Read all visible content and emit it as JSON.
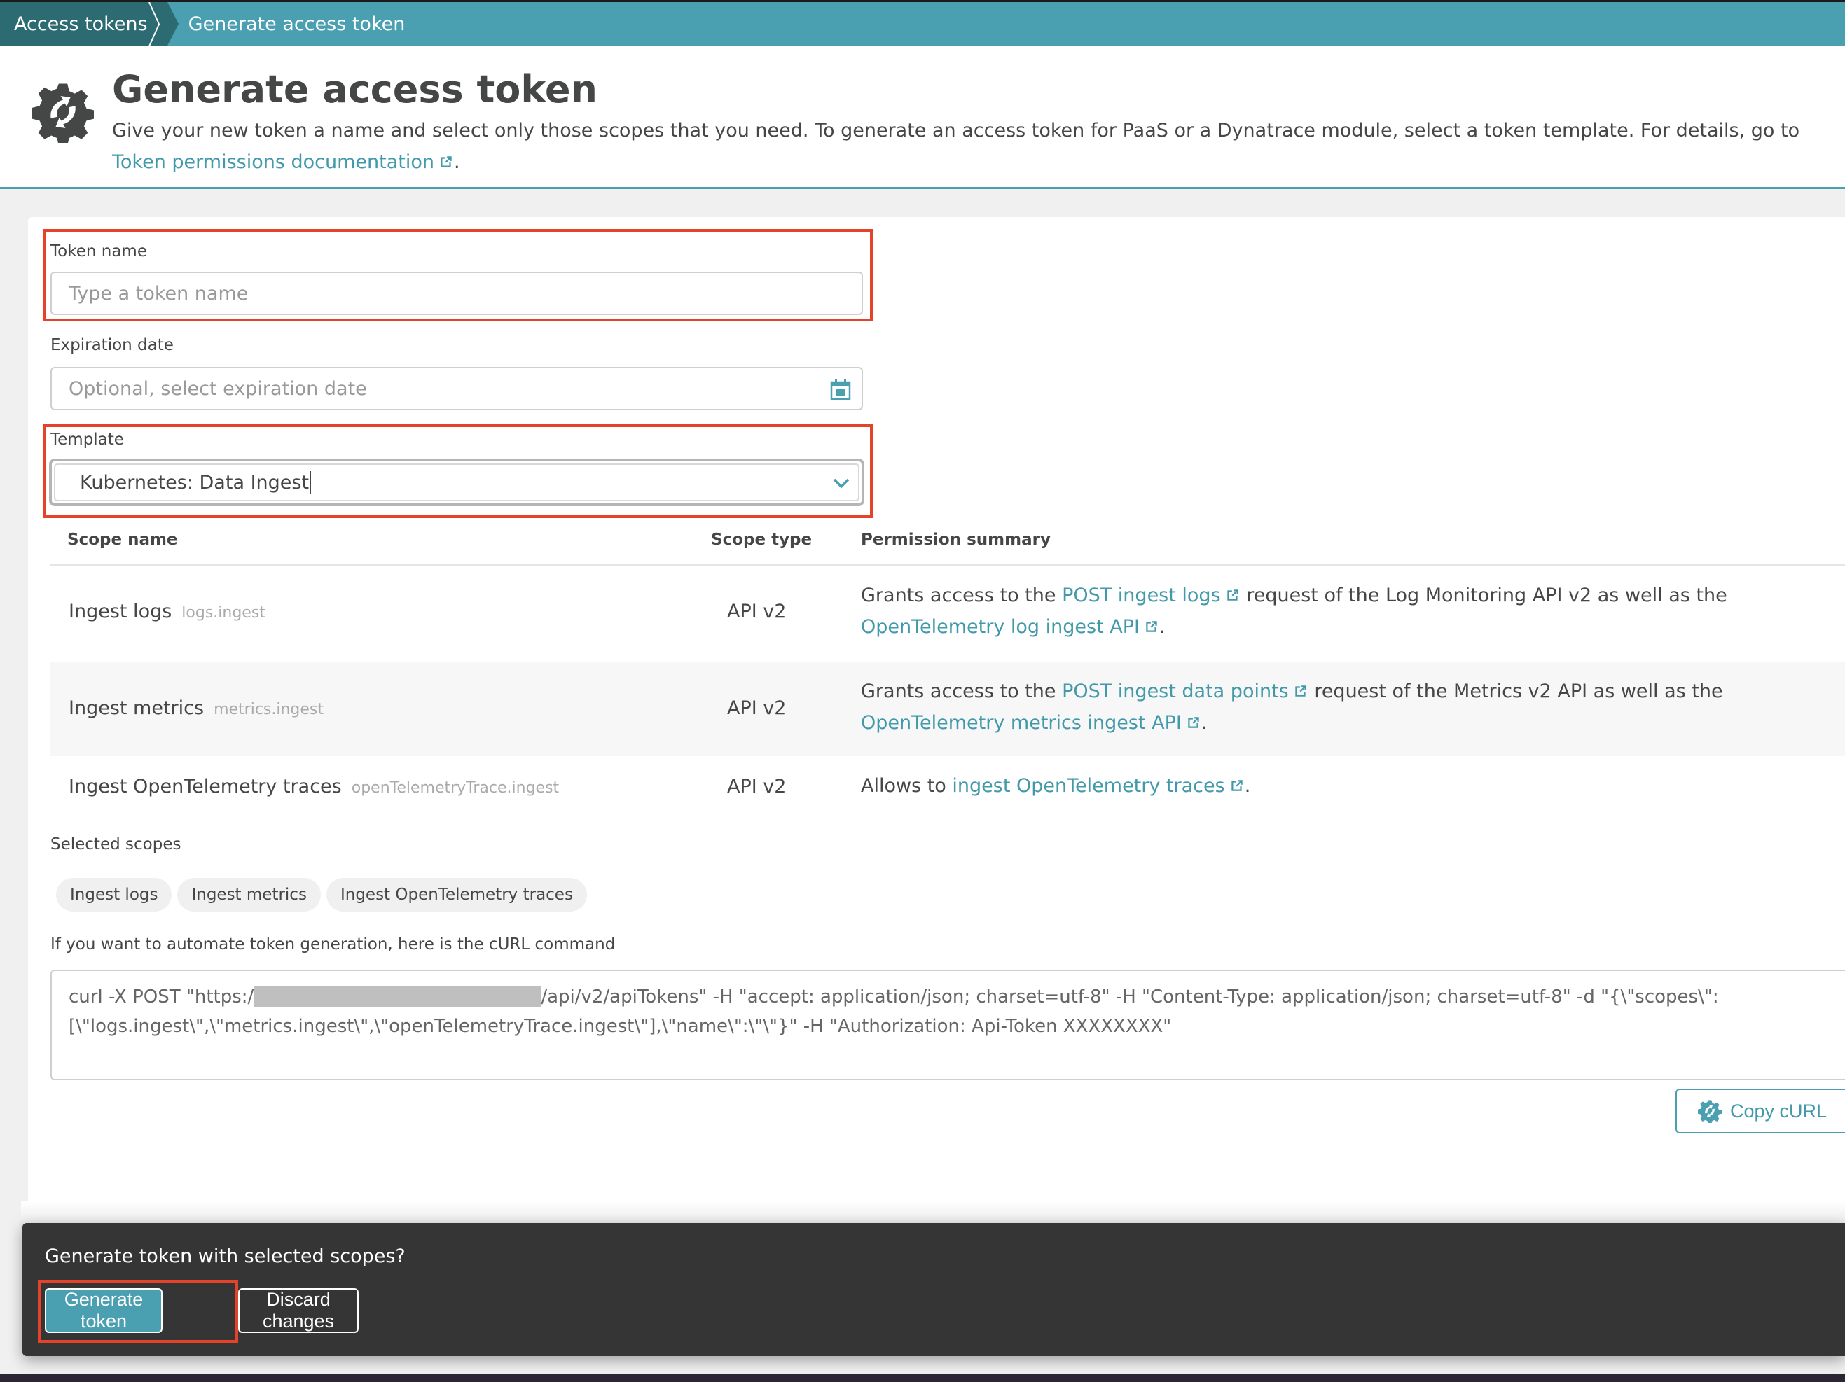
{
  "breadcrumb": {
    "items": [
      "Access tokens",
      "Generate access token"
    ]
  },
  "header": {
    "icon": "gear-sync-icon",
    "title": "Generate access token",
    "description": "Give your new token a name and select only those scopes that you need. To generate an access token for PaaS or a Dynatrace module, select a token template. For details, go to ",
    "doc_link": "Token permissions documentation",
    "description_end": "."
  },
  "form": {
    "token_name": {
      "label": "Token name",
      "placeholder": "Type a token name",
      "value": ""
    },
    "expiration_date": {
      "label": "Expiration date",
      "placeholder": "Optional, select expiration date",
      "icon": "calendar-icon"
    },
    "template": {
      "label": "Template",
      "value": "Kubernetes: Data Ingest",
      "icon": "chevron-down-icon"
    }
  },
  "table": {
    "headers": [
      "Scope name",
      "Scope type",
      "Permission summary"
    ],
    "rows": [
      {
        "name": "Ingest logs",
        "key": "logs.ingest",
        "type": "API v2",
        "perm": [
          {
            "t": "Grants access to the "
          },
          {
            "link": "POST ingest logs"
          },
          {
            "t": " request of the Log Monitoring API v2 as well as the "
          },
          {
            "link": "OpenTelemetry log ingest API"
          },
          {
            "t": "."
          }
        ]
      },
      {
        "name": "Ingest metrics",
        "key": "metrics.ingest",
        "type": "API v2",
        "perm": [
          {
            "t": "Grants access to the "
          },
          {
            "link": "POST ingest data points"
          },
          {
            "t": " request of the Metrics v2 API as well as the "
          },
          {
            "link": "OpenTelemetry metrics ingest API"
          },
          {
            "t": "."
          }
        ]
      },
      {
        "name": "Ingest OpenTelemetry traces",
        "key": "openTelemetryTrace.ingest",
        "type": "API v2",
        "perm": [
          {
            "t": "Allows to "
          },
          {
            "link": "ingest OpenTelemetry traces"
          },
          {
            "t": "."
          }
        ]
      }
    ]
  },
  "selected_scopes": {
    "label": "Selected scopes",
    "tags": [
      "Ingest logs",
      "Ingest metrics",
      "Ingest OpenTelemetry traces"
    ]
  },
  "curl": {
    "label": "If you want to automate token generation, here is the cURL command",
    "prefix": "curl -X POST \"https:/",
    "suffix": "/api/v2/apiTokens\" -H \"accept: application/json; charset=utf-8\" -H \"Content-Type: application/json; charset=utf-8\" -d \"{\\\"scopes\\\":\n[\\\"logs.ingest\\\",\\\"metrics.ingest\\\",\\\"openTelemetryTrace.ingest\\\"],\\\"name\\\":\\\"\\\"}\" -H \"Authorization: Api-Token XXXXXXXX\"",
    "copy_button": "Copy cURL"
  },
  "bottom_bar": {
    "message": "Generate token with selected scopes?",
    "primary": "Generate token",
    "secondary": "Discard changes"
  },
  "colors": {
    "accent": "#4a9fb1",
    "breadcrumb_dark": "#2d6b73",
    "highlight": "#e4432a",
    "bar": "#353535"
  }
}
